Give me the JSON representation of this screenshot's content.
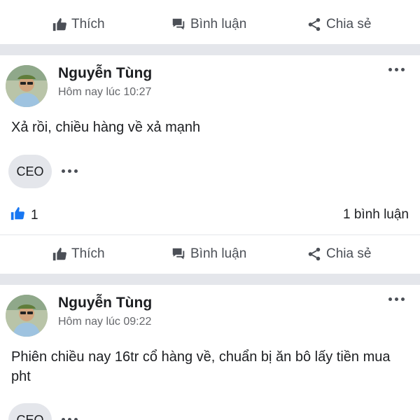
{
  "actions": {
    "like_label": "Thích",
    "comment_label": "Bình luận",
    "share_label": "Chia sẻ"
  },
  "posts": [
    {
      "author": "Nguyễn Tùng",
      "time": "Hôm nay lúc 10:27",
      "text": "Xả rồi, chiều hàng về xả mạnh",
      "tag": "CEO",
      "like_count": "1",
      "comment_count": "1 bình luận"
    },
    {
      "author": "Nguyễn Tùng",
      "time": "Hôm nay lúc 09:22",
      "text": "Phiên chiều nay 16tr cổ hàng về, chuẩn bị ăn bô lấy tiền mua pht",
      "tag": "CEO"
    }
  ],
  "colors": {
    "separator": "#e4e6eb",
    "like_blue": "#1877f2",
    "secondary_text": "#65676b",
    "icon_gray": "#4b4f56"
  }
}
